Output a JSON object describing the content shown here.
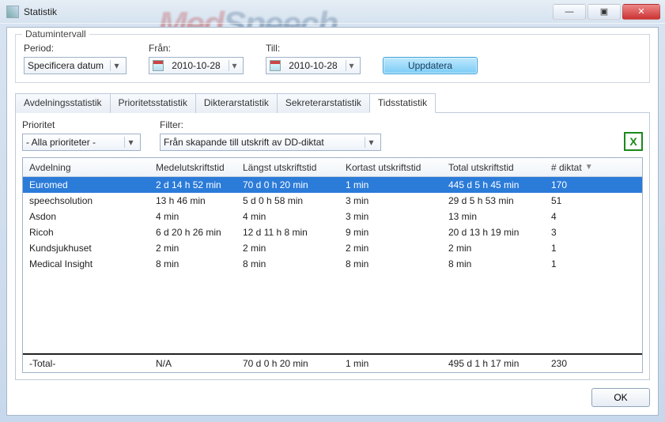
{
  "window": {
    "title": "Statistik"
  },
  "bg_brand": {
    "left": "Med",
    "right": "Speech"
  },
  "win_buttons": {
    "min": "—",
    "max": "▣",
    "close": "✕"
  },
  "date_group": {
    "legend": "Datumintervall",
    "period_label": "Period:",
    "period_value": "Specificera datum",
    "from_label": "Från:",
    "from_value": "2010-10-28",
    "to_label": "Till:",
    "to_value": "2010-10-28",
    "update_label": "Uppdatera"
  },
  "tabs": {
    "t0": "Avdelningsstatistik",
    "t1": "Prioritetsstatistik",
    "t2": "Dikterarstatistik",
    "t3": "Sekreterarstatistik",
    "t4": "Tidsstatistik"
  },
  "filters": {
    "prio_label": "Prioritet",
    "prio_value": "- Alla prioriteter -",
    "filter_label": "Filter:",
    "filter_value": "Från skapande till utskrift av DD-diktat"
  },
  "columns": {
    "c0": "Avdelning",
    "c1": "Medelutskriftstid",
    "c2": "Längst utskriftstid",
    "c3": "Kortast utskriftstid",
    "c4": "Total utskriftstid",
    "c5": "# diktat"
  },
  "rows": [
    {
      "c0": "Euromed",
      "c1": "2 d 14 h 52 min",
      "c2": "70 d 0 h 20 min",
      "c3": "1 min",
      "c4": "445 d 5 h 45 min",
      "c5": "170"
    },
    {
      "c0": "speechsolution",
      "c1": "13 h 46 min",
      "c2": "5 d 0 h 58 min",
      "c3": "3 min",
      "c4": "29 d 5 h 53 min",
      "c5": "51"
    },
    {
      "c0": "Asdon",
      "c1": "4 min",
      "c2": "4 min",
      "c3": "3 min",
      "c4": "13 min",
      "c5": "4"
    },
    {
      "c0": "Ricoh",
      "c1": "6 d 20 h 26 min",
      "c2": "12 d 11 h 8 min",
      "c3": "9 min",
      "c4": "20 d 13 h 19 min",
      "c5": "3"
    },
    {
      "c0": "Kundsjukhuset",
      "c1": "2 min",
      "c2": "2 min",
      "c3": "2 min",
      "c4": "2 min",
      "c5": "1"
    },
    {
      "c0": "Medical Insight",
      "c1": "8 min",
      "c2": "8 min",
      "c3": "8 min",
      "c4": "8 min",
      "c5": "1"
    }
  ],
  "total": {
    "c0": "-Total-",
    "c1": "N/A",
    "c2": "70 d 0 h 20 min",
    "c3": "1 min",
    "c4": "495 d 1 h 17 min",
    "c5": "230"
  },
  "footer": {
    "ok": "OK"
  }
}
